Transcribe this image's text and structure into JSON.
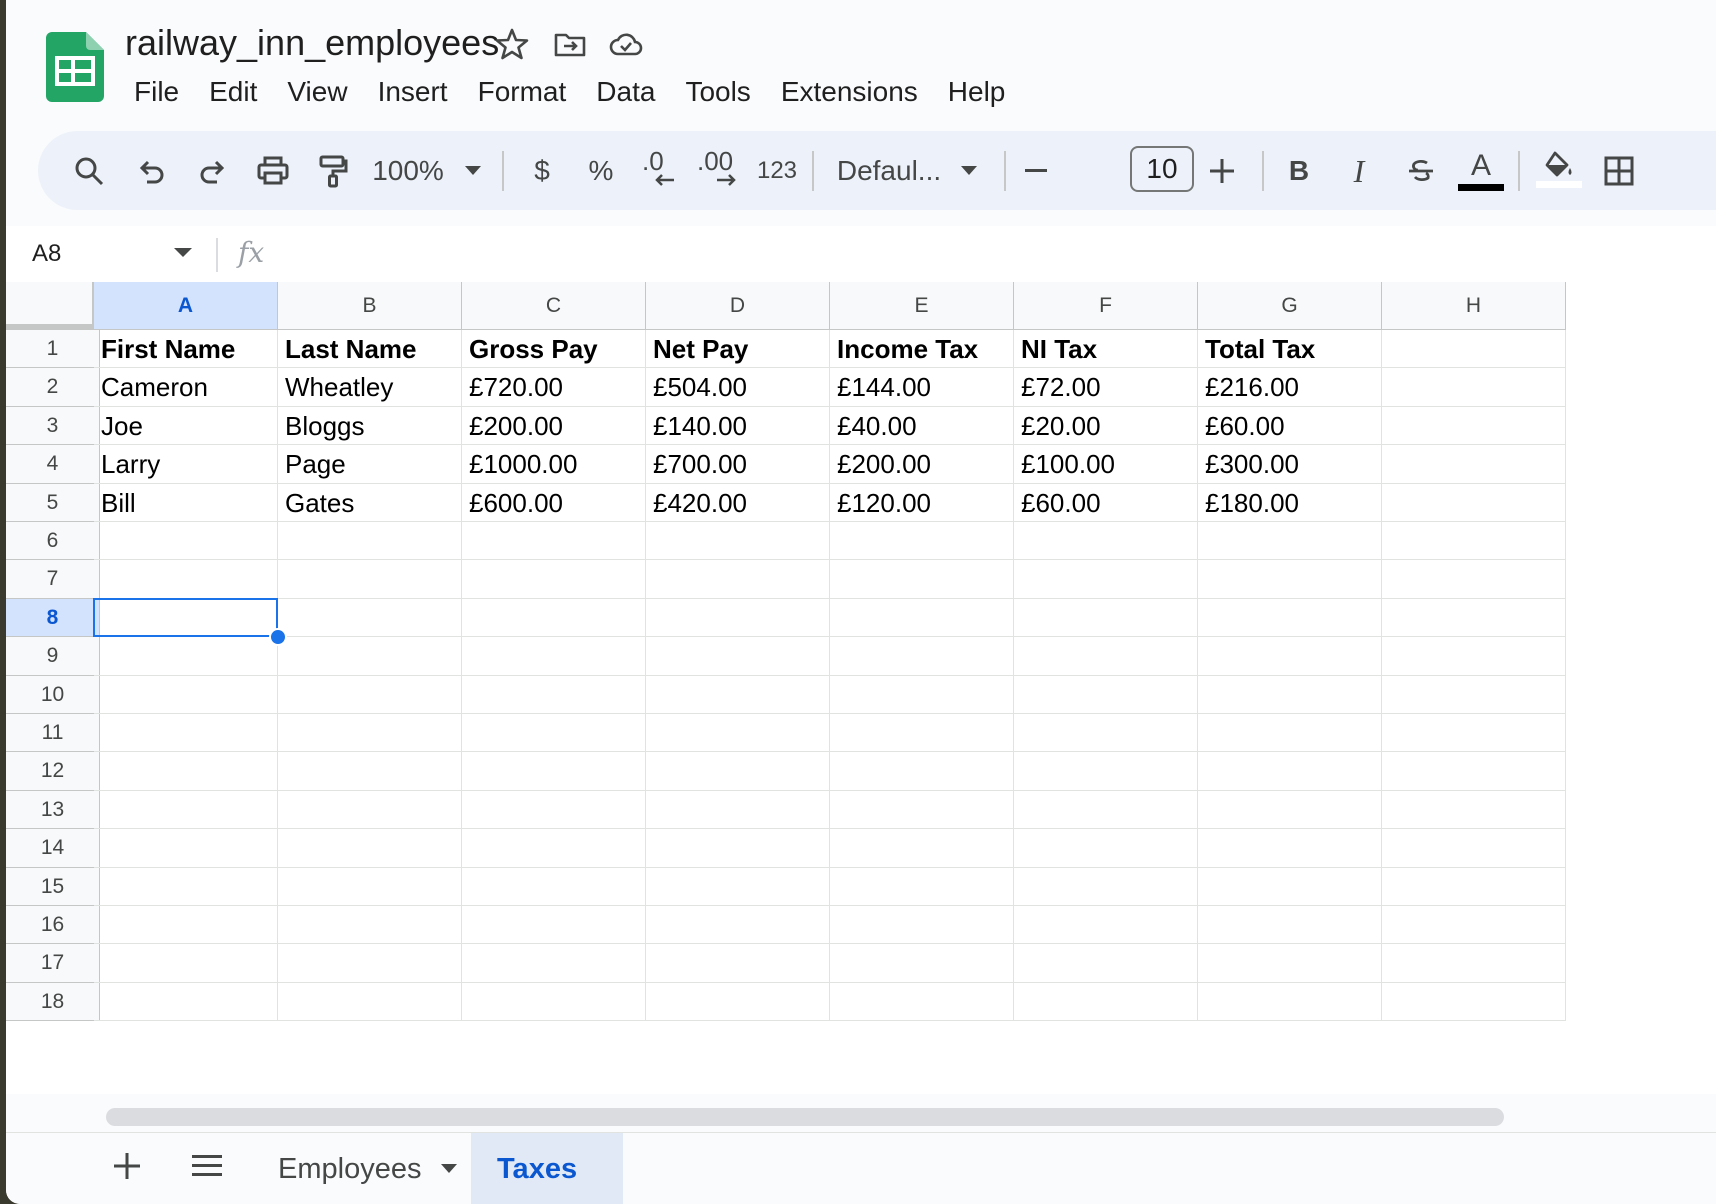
{
  "doc": {
    "title": "railway_inn_employees"
  },
  "menu": [
    "File",
    "Edit",
    "View",
    "Insert",
    "Format",
    "Data",
    "Tools",
    "Extensions",
    "Help"
  ],
  "toolbar": {
    "zoom": "100%",
    "currency": "$",
    "percent": "%",
    "decrease_decimal": ".0",
    "increase_decimal": ".00",
    "number_format": "123",
    "font": "Defaul...",
    "font_size": "10",
    "bold": "B",
    "italic": "I",
    "text_color_letter": "A",
    "icons": [
      "search-icon",
      "undo-icon",
      "redo-icon",
      "print-icon",
      "paint-format-icon",
      "fill-color-icon",
      "borders-icon",
      "strikethrough-icon"
    ]
  },
  "formula_bar": {
    "name_box": "A8",
    "fx": "fx",
    "value": ""
  },
  "grid": {
    "columns": [
      "A",
      "B",
      "C",
      "D",
      "E",
      "F",
      "G",
      "H"
    ],
    "selected_column": "A",
    "row_numbers": [
      "1",
      "2",
      "3",
      "4",
      "5",
      "6",
      "7",
      "8",
      "9",
      "10",
      "11",
      "12",
      "13",
      "14",
      "15",
      "16",
      "17",
      "18"
    ],
    "selected_row": "8",
    "selected_cell": "A8",
    "rows": [
      [
        "First Name",
        "Last Name",
        "Gross Pay",
        "Net Pay",
        "Income Tax",
        "NI Tax",
        "Total Tax",
        ""
      ],
      [
        "Cameron",
        "Wheatley",
        "£720.00",
        "£504.00",
        "£144.00",
        "£72.00",
        "£216.00",
        ""
      ],
      [
        "Joe",
        "Bloggs",
        "£200.00",
        "£140.00",
        "£40.00",
        "£20.00",
        "£60.00",
        ""
      ],
      [
        "Larry",
        "Page",
        "£1000.00",
        "£700.00",
        "£200.00",
        "£100.00",
        "£300.00",
        ""
      ],
      [
        "Bill",
        "Gates",
        "£600.00",
        "£420.00",
        "£120.00",
        "£60.00",
        "£180.00",
        ""
      ]
    ]
  },
  "sheets": [
    {
      "label": "Employees",
      "active": false
    },
    {
      "label": "Taxes",
      "active": true
    }
  ],
  "colors": {
    "accent": "#0b57d0",
    "selection": "#1a73e8",
    "selected_header": "#d3e3fd",
    "sheets_green": "#188038"
  }
}
